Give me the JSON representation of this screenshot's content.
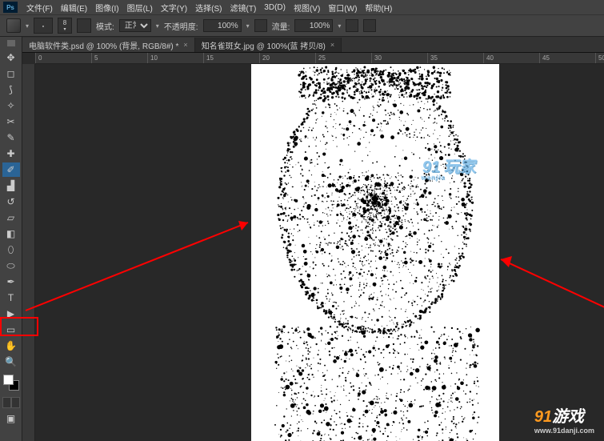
{
  "menu": {
    "file": "文件(F)",
    "edit": "编辑(E)",
    "image": "图像(I)",
    "layer": "图层(L)",
    "type": "文字(Y)",
    "select": "选择(S)",
    "filter": "滤镜(T)",
    "threeD": "3D(D)",
    "view": "视图(V)",
    "window": "窗口(W)",
    "help": "帮助(H)"
  },
  "options": {
    "brushSize": "8",
    "brushChev": "▾",
    "modeLabel": "模式:",
    "modeVal": "正常",
    "opacityLabel": "不透明度:",
    "opacityVal": "100%",
    "flowLabel": "流量:",
    "flowVal": "100%"
  },
  "tabs": [
    {
      "label": "电脑软件类.psd @ 100% (背景, RGB/8#) *"
    },
    {
      "label": "知名雀斑女.jpg @ 100%(蓝 拷贝/8)"
    }
  ],
  "activeTab": 1,
  "rulerH": [
    "0",
    "5",
    "10",
    "15",
    "20",
    "25",
    "30",
    "35",
    "40",
    "45",
    "50"
  ],
  "watermark1": {
    "brand": "91 玩家",
    "sub": "wanjia"
  },
  "watermark2": {
    "brand_num": "91",
    "brand_txt": "游戏",
    "url": "www.91danji.com"
  }
}
